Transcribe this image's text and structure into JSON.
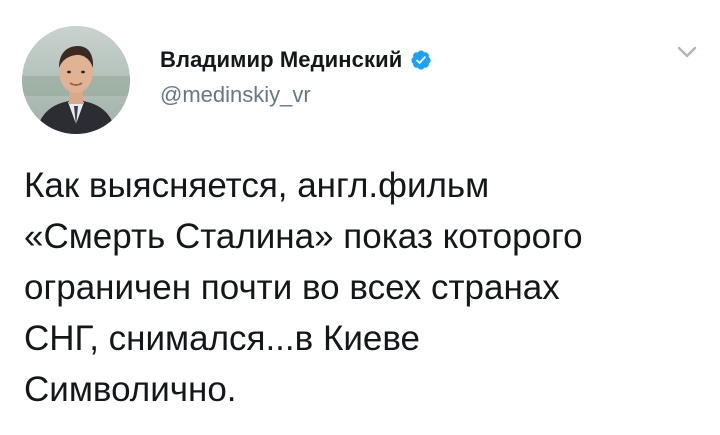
{
  "tweet": {
    "author": {
      "display_name": "Владимир Мединский",
      "handle": "@medinskiy_vr",
      "verified": true
    },
    "text": "Как выясняется, англ.фильм\n«Смерть Сталина» показ которого\nограничен почти во всех странах\nСНГ, снимался...в Киеве\nСимволично.",
    "icons": {
      "verified": "verified-badge-icon",
      "menu": "chevron-down-icon"
    },
    "colors": {
      "verified_badge": "#1da1f2",
      "handle": "#657786",
      "text": "#14171a",
      "caret": "#aab8c2"
    }
  }
}
